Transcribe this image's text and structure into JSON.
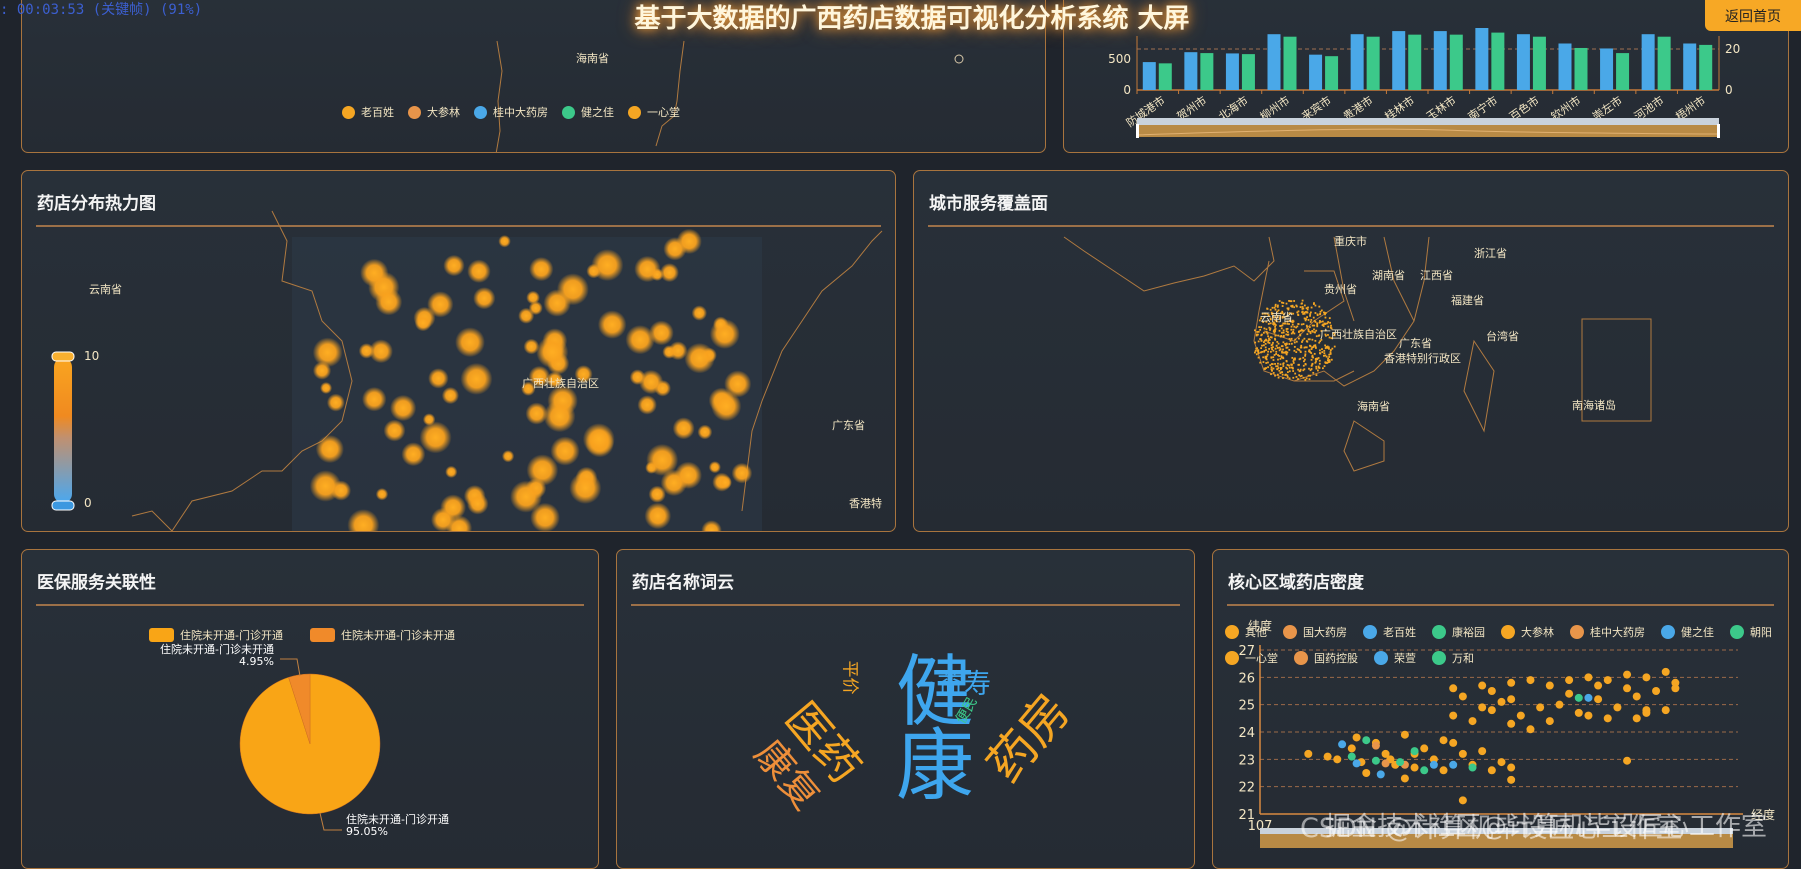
{
  "header": {
    "title": "基于大数据的广西药店数据可视化分析系统 大屏",
    "back_button": "返回首页",
    "recorder_status": ": 00:03:53 (关键帧) (91%)"
  },
  "colors": {
    "orange": "#f5a623",
    "orange2": "#e8954a",
    "blue": "#4aa8e8",
    "green": "#3cc98a",
    "border": "#a8743e"
  },
  "top_left": {
    "map_label": "海南省",
    "legend": [
      {
        "label": "老百姓",
        "color": "#f5a623"
      },
      {
        "label": "大参林",
        "color": "#e8954a"
      },
      {
        "label": "桂中大药房",
        "color": "#4aa8e8"
      },
      {
        "label": "健之佳",
        "color": "#3cc98a"
      },
      {
        "label": "一心堂",
        "color": "#f5a623"
      }
    ]
  },
  "heatmap_panel": {
    "title": "药店分布热力图",
    "labels": {
      "yunnan": "云南省",
      "guangxi": "广西壮族自治区",
      "guangdong": "广东省",
      "hongkong": "香港特"
    },
    "visual_max": "10",
    "visual_min": "0"
  },
  "coverage_panel": {
    "title": "城市服务覆盖面",
    "labels": {
      "chongqing": "重庆市",
      "zhejiang": "浙江省",
      "hunan": "湖南省",
      "jiangxi": "江西省",
      "guizhou": "贵州省",
      "fujian": "福建省",
      "yunnan": "云南省",
      "taiwan": "台湾省",
      "guangxi": "广西壮族自治区",
      "guangdong": "广东省",
      "hongkong": "香港特别行政区",
      "hainan": "海南省",
      "nanhai": "南海诸岛"
    }
  },
  "pie_panel": {
    "title": "医保服务关联性"
  },
  "wordcloud_panel": {
    "title": "药店名称词云",
    "words": [
      {
        "text": "健康",
        "color": "#3ea6ee"
      },
      {
        "text": "药房",
        "color": "#f5a623"
      },
      {
        "text": "医药",
        "color": "#f5a623"
      },
      {
        "text": "康复",
        "color": "#ee8f3a"
      },
      {
        "text": "益寿",
        "color": "#3ea6ee"
      },
      {
        "text": "平价",
        "color": "#f5a623"
      },
      {
        "text": "便民",
        "color": "#3cc98a"
      }
    ]
  },
  "scatter_panel": {
    "title": "核心区域药店密度"
  },
  "watermark": {
    "line1": "CSDN @计算机毕设匠心工作室",
    "line2": "掘金技术社区@计算机毕设匠心工作室"
  },
  "chart_data": [
    {
      "type": "bar",
      "categories": [
        "防城港市",
        "贺州市",
        "北海市",
        "柳州市",
        "来宾市",
        "贵港市",
        "桂林市",
        "玉林市",
        "南宁市",
        "百色市",
        "钦州市",
        "崇左市",
        "河池市",
        "梧州市"
      ],
      "series": [
        {
          "name": "left",
          "axis": "left",
          "color": "#4aa8e8",
          "values": [
            450,
            610,
            590,
            900,
            570,
            900,
            950,
            950,
            1000,
            900,
            750,
            670,
            900,
            750
          ]
        },
        {
          "name": "right",
          "axis": "right",
          "color": "#3cc98a",
          "values": [
            13,
            18,
            17.5,
            26,
            16.5,
            26,
            27,
            27,
            28,
            26,
            20.5,
            18,
            26,
            22
          ]
        }
      ],
      "left_ticks": [
        "0",
        "500"
      ],
      "right_ticks": [
        "0",
        "20"
      ],
      "left_ylim": [
        0,
        700
      ],
      "right_ylim": [
        0,
        21
      ],
      "dashed_line_value_right": 20
    },
    {
      "type": "pie",
      "legend": [
        "住院未开通-门诊开通",
        "住院未开通-门诊未开通"
      ],
      "slices": [
        {
          "name": "住院未开通-门诊开通",
          "value": 95.05,
          "label": "95.05%",
          "color": "#f9a516"
        },
        {
          "name": "住院未开通-门诊未开通",
          "value": 4.95,
          "label": "4.95%",
          "color": "#f08a2a"
        }
      ]
    },
    {
      "type": "scatter",
      "ylabel": "纬度",
      "xlabel": "经度",
      "xlim": [
        107,
        112
      ],
      "ylim": [
        21,
        27
      ],
      "x_ticks": [
        "107"
      ],
      "y_ticks": [
        "21",
        "22",
        "23",
        "24",
        "25",
        "26",
        "27"
      ],
      "legend": [
        "其他",
        "国大药房",
        "老百姓",
        "康裕园",
        "大参林",
        "桂中大药房",
        "健之佳",
        "朝阳",
        "一心堂",
        "国药控股",
        "荣萱",
        "万和"
      ],
      "series": [
        {
          "name": "其他",
          "color": "#f5a623",
          "points": [
            [
              109.0,
              25.6
            ],
            [
              109.1,
              25.3
            ],
            [
              109.3,
              25.7
            ],
            [
              109.4,
              25.5
            ],
            [
              109.6,
              25.8
            ],
            [
              109.8,
              25.9
            ],
            [
              110.0,
              25.7
            ],
            [
              110.2,
              25.9
            ],
            [
              110.4,
              26.0
            ],
            [
              110.6,
              25.9
            ],
            [
              110.8,
              26.1
            ],
            [
              111.0,
              26.0
            ],
            [
              111.2,
              26.2
            ],
            [
              111.3,
              25.8
            ],
            [
              109.0,
              24.6
            ],
            [
              109.2,
              24.4
            ],
            [
              109.4,
              24.8
            ],
            [
              109.6,
              24.3
            ],
            [
              109.7,
              24.6
            ],
            [
              109.9,
              24.9
            ],
            [
              110.1,
              25.0
            ],
            [
              110.2,
              25.4
            ],
            [
              110.3,
              24.7
            ],
            [
              110.5,
              25.2
            ],
            [
              110.6,
              24.5
            ],
            [
              110.7,
              24.9
            ],
            [
              110.9,
              25.3
            ],
            [
              111.0,
              24.7
            ],
            [
              111.1,
              25.5
            ],
            [
              111.3,
              25.6
            ],
            [
              109.5,
              25.1
            ],
            [
              109.8,
              24.1
            ],
            [
              110.4,
              24.6
            ],
            [
              110.8,
              25.6
            ],
            [
              111.2,
              24.8
            ],
            [
              109.3,
              24.9
            ],
            [
              110.0,
              24.4
            ],
            [
              110.9,
              24.5
            ],
            [
              109.6,
              25.2
            ],
            [
              110.5,
              25.7
            ],
            [
              107.5,
              23.2
            ],
            [
              107.7,
              23.1
            ],
            [
              107.8,
              23.0
            ],
            [
              107.95,
              23.4
            ],
            [
              108.05,
              22.9
            ],
            [
              108.1,
              22.5
            ],
            [
              108.2,
              23.6
            ],
            [
              108.3,
              23.2
            ],
            [
              108.4,
              22.8
            ],
            [
              108.5,
              23.9
            ],
            [
              108.5,
              22.3
            ],
            [
              108.6,
              22.7
            ],
            [
              108.7,
              23.4
            ],
            [
              108.8,
              23.0
            ],
            [
              108.9,
              22.6
            ],
            [
              109.0,
              23.6
            ],
            [
              109.1,
              23.2
            ],
            [
              109.2,
              22.8
            ],
            [
              109.3,
              23.3
            ],
            [
              109.4,
              22.6
            ],
            [
              109.5,
              22.9
            ],
            [
              109.6,
              22.7
            ],
            [
              108.9,
              23.7
            ],
            [
              108.35,
              23.0
            ],
            [
              108.6,
              23.2
            ],
            [
              109.6,
              22.25
            ],
            [
              109.1,
              21.5
            ],
            [
              110.8,
              22.95
            ],
            [
              111.0,
              24.8
            ],
            [
              108.0,
              23.8
            ]
          ]
        },
        {
          "name": "国大药房",
          "color": "#e8954a",
          "points": [
            [
              108.3,
              22.85
            ],
            [
              108.5,
              22.8
            ],
            [
              108.2,
              23.5
            ]
          ]
        },
        {
          "name": "老百姓",
          "color": "#4aa8e8",
          "points": [
            [
              107.85,
              23.55
            ],
            [
              108.25,
              22.45
            ],
            [
              108.8,
              22.8
            ],
            [
              110.4,
              25.25
            ]
          ]
        },
        {
          "name": "康裕园",
          "color": "#3cc98a",
          "points": [
            [
              107.95,
              23.1
            ],
            [
              108.1,
              23.7
            ],
            [
              108.45,
              22.9
            ],
            [
              109.2,
              22.7
            ],
            [
              108.7,
              22.6
            ]
          ]
        },
        {
          "name": "朝阳",
          "color": "#3cc98a",
          "points": [
            [
              110.3,
              25.25
            ]
          ]
        },
        {
          "name": "荣萱",
          "color": "#4aa8e8",
          "points": [
            [
              108.0,
              22.85
            ],
            [
              109.0,
              22.8
            ]
          ]
        },
        {
          "name": "万和",
          "color": "#3cc98a",
          "points": [
            [
              108.6,
              23.3
            ],
            [
              108.2,
              22.95
            ]
          ]
        }
      ]
    },
    {
      "type": "heatmap",
      "visual_range": [
        0,
        10
      ]
    }
  ]
}
